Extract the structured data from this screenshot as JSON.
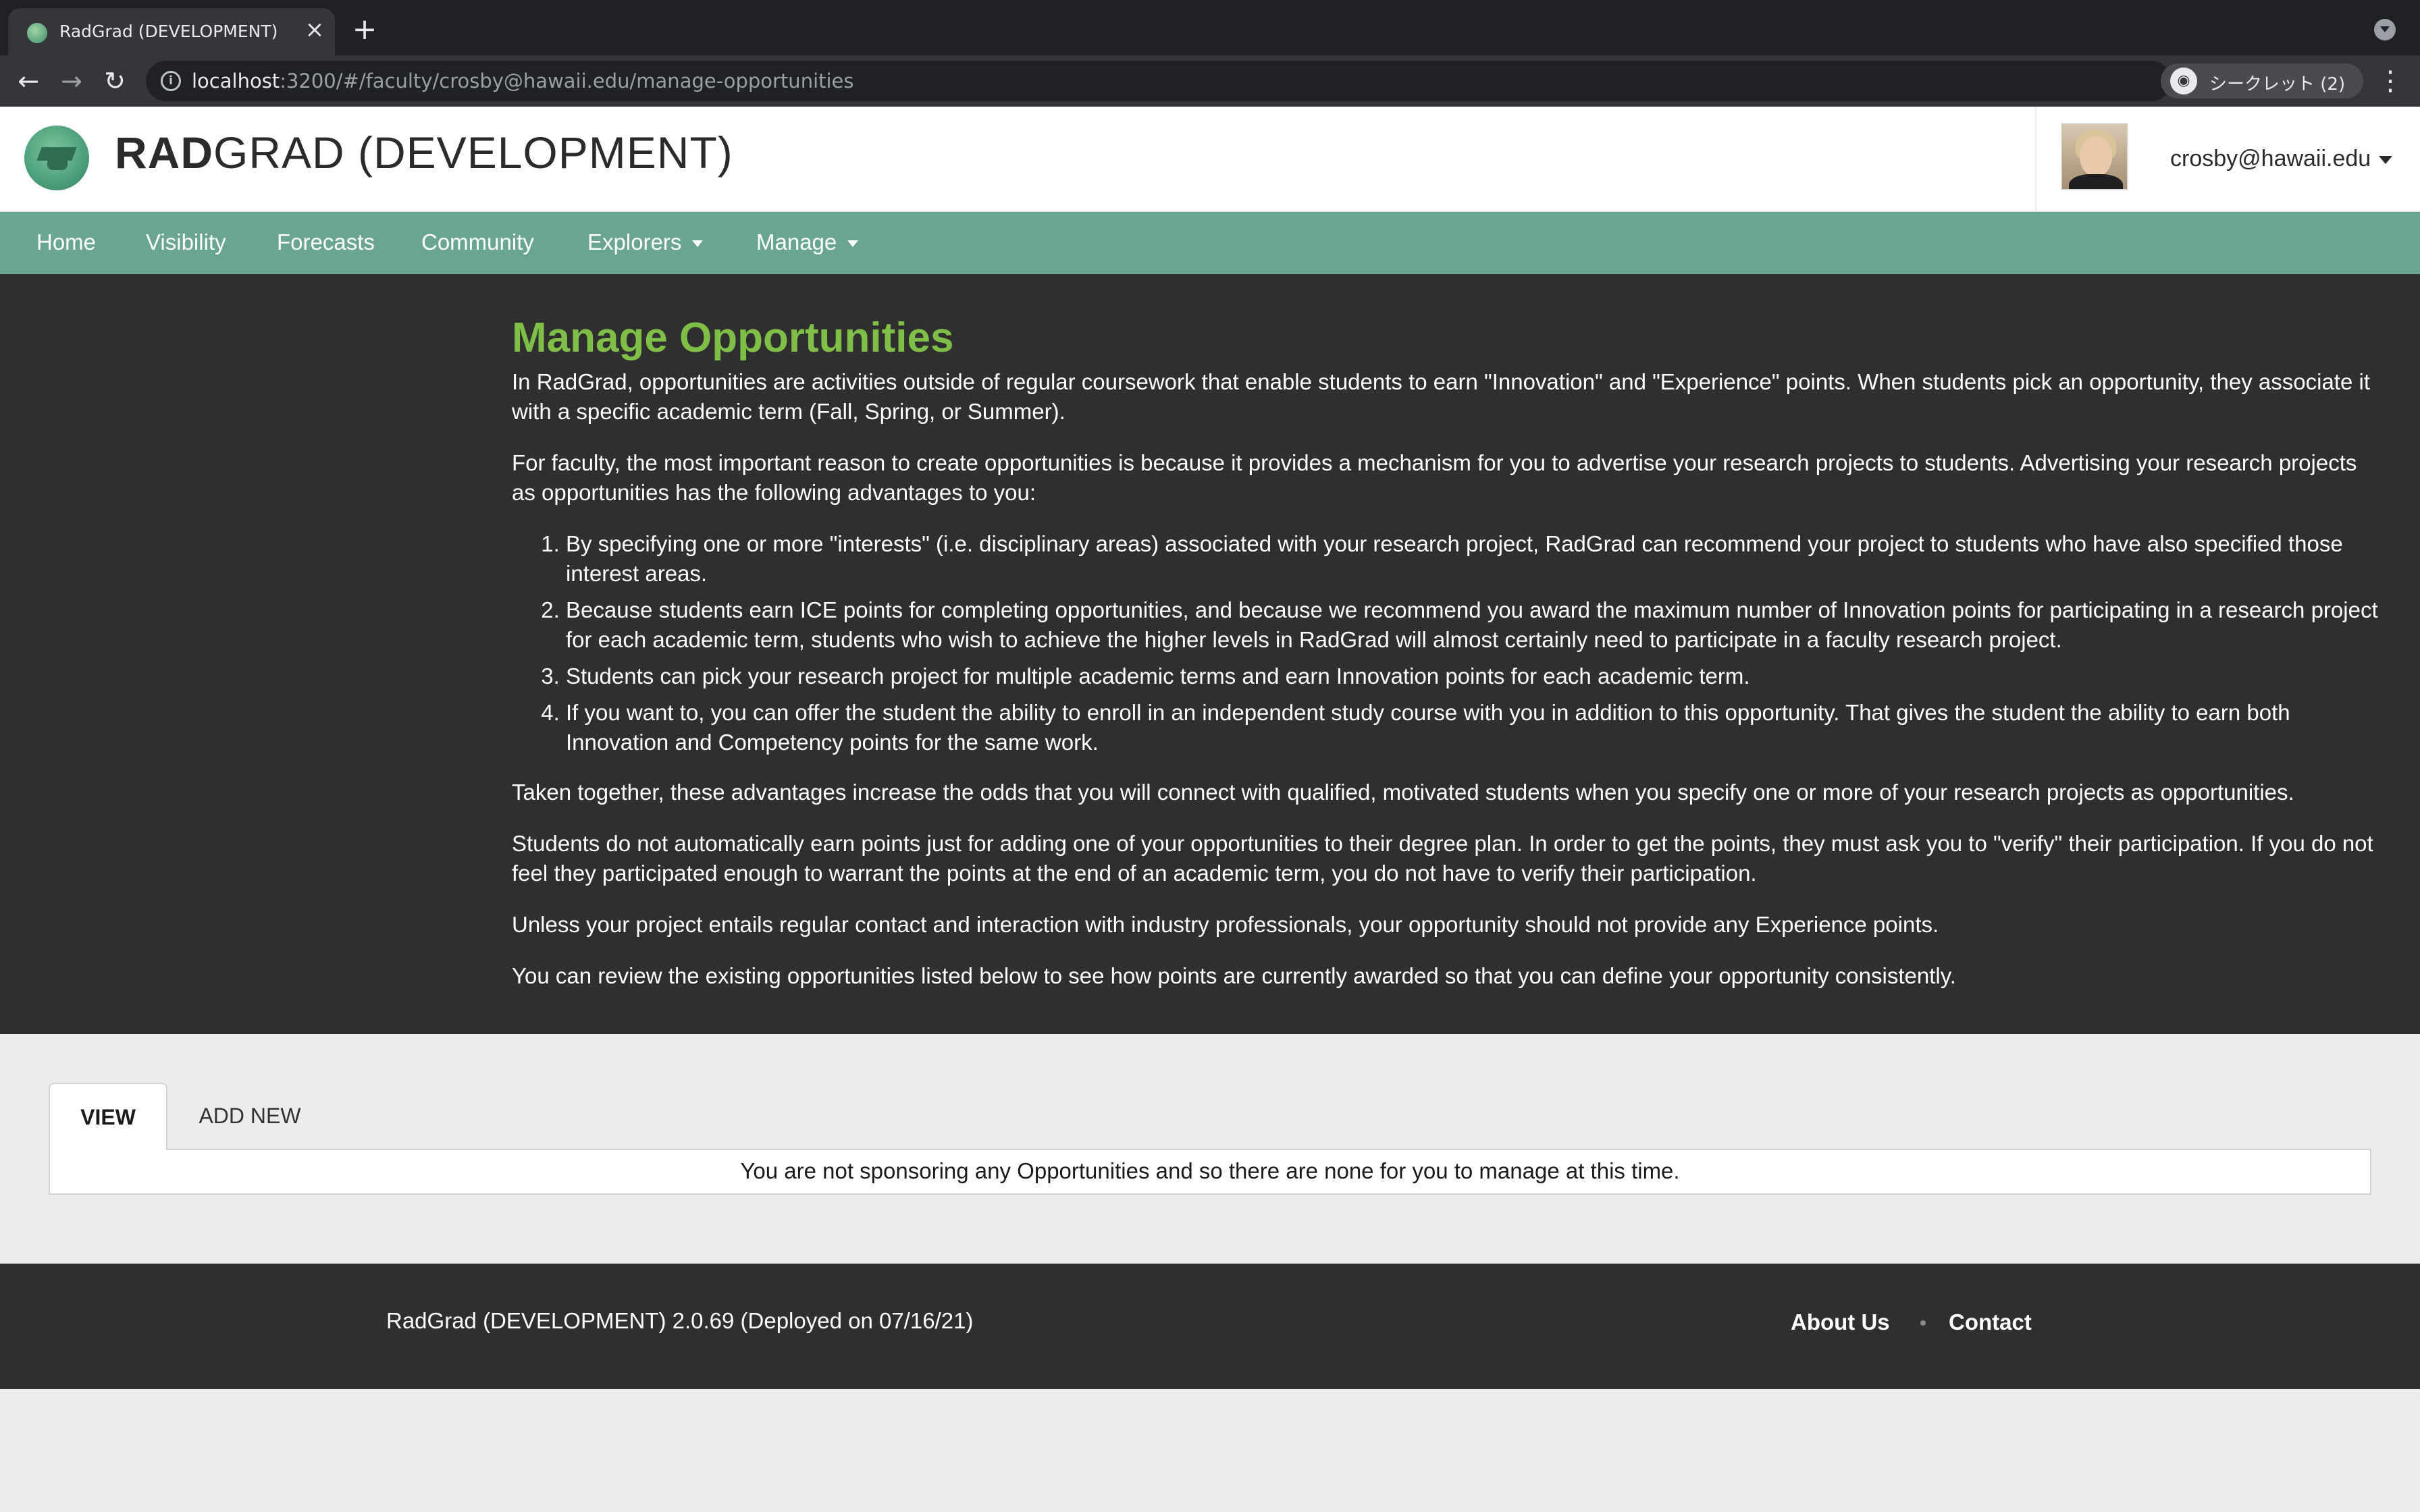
{
  "browser": {
    "tab_title": "RadGrad (DEVELOPMENT)",
    "url_host": "localhost",
    "url_rest": ":3200/#/faculty/crosby@hawaii.edu/manage-opportunities",
    "incognito_label": "シークレット (2)"
  },
  "header": {
    "brand_bold": "RAD",
    "brand_rest": "GRAD (DEVELOPMENT)",
    "user_email": "crosby@hawaii.edu"
  },
  "nav": {
    "items": [
      {
        "label": "Home"
      },
      {
        "label": "Visibility"
      },
      {
        "label": "Forecasts"
      },
      {
        "label": "Community"
      },
      {
        "label": "Explorers"
      },
      {
        "label": "Manage"
      }
    ]
  },
  "intro": {
    "title": "Manage Opportunities",
    "p1": "In RadGrad, opportunities are activities outside of regular coursework that enable students to earn \"Innovation\" and \"Experience\" points. When students pick an opportunity, they associate it with a specific academic term (Fall, Spring, or Summer).",
    "p2": "For faculty, the most important reason to create opportunities is because it provides a mechanism for you to advertise your research projects to students. Advertising your research projects as opportunities has the following advantages to you:",
    "advantages": [
      "By specifying one or more \"interests\" (i.e. disciplinary areas) associated with your research project, RadGrad can recommend your project to students who have also specified those interest areas.",
      "Because students earn ICE points for completing opportunities, and because we recommend you award the maximum number of Innovation points for participating in a research project for each academic term, students who wish to achieve the higher levels in RadGrad will almost certainly need to participate in a faculty research project.",
      "Students can pick your research project for multiple academic terms and earn Innovation points for each academic term.",
      "If you want to, you can offer the student the ability to enroll in an independent study course with you in addition to this opportunity. That gives the student the ability to earn both Innovation and Competency points for the same work."
    ],
    "p3": "Taken together, these advantages increase the odds that you will connect with qualified, motivated students when you specify one or more of your research projects as opportunities.",
    "p4": "Students do not automatically earn points just for adding one of your opportunities to their degree plan. In order to get the points, they must ask you to \"verify\" their participation. If you do not feel they participated enough to warrant the points at the end of an academic term, you do not have to verify their participation.",
    "p5": "Unless your project entails regular contact and interaction with industry professionals, your opportunity should not provide any Experience points.",
    "p6": "You can review the existing opportunities listed below to see how points are currently awarded so that you can define your opportunity consistently."
  },
  "tabs": {
    "view_label": "VIEW",
    "add_label": "ADD NEW",
    "empty_message": "You are not sponsoring any Opportunities and so there are none for you to manage at this time."
  },
  "footer": {
    "version": "RadGrad (DEVELOPMENT) 2.0.69 (Deployed on 07/16/21)",
    "about": "About Us",
    "contact": "Contact"
  },
  "colors": {
    "nav_green": "#6aa68f",
    "title_green": "#7fbf48",
    "dark_bg": "#2f2f2f"
  }
}
